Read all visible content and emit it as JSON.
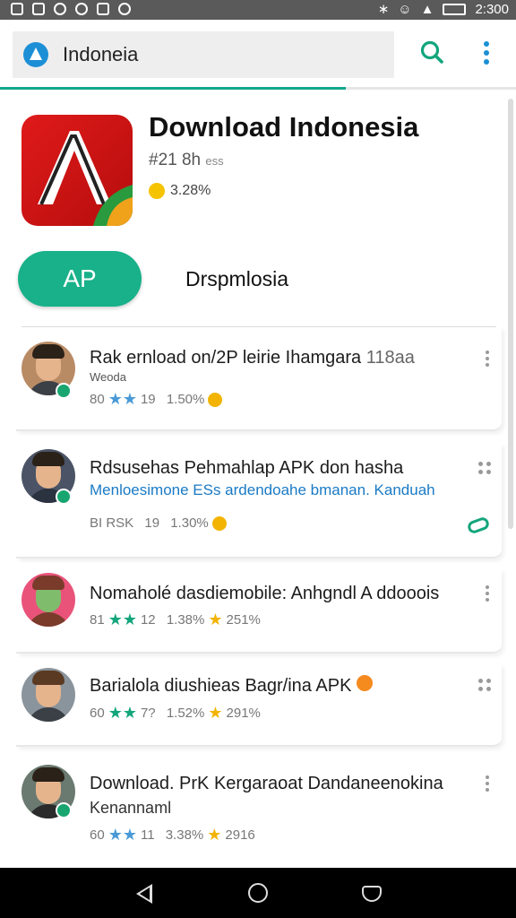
{
  "status_bar": {
    "time": "2:300"
  },
  "search": {
    "query": "Indoneia"
  },
  "load_progress": 0.67,
  "app": {
    "title": "Download Indonesia",
    "rank": "#21 8h",
    "rank_suffix": "ess",
    "rating": "3.28%",
    "install_label": "AP",
    "developer": "Drspmlosia"
  },
  "list": [
    {
      "title": "Rak ernload on/2P leirie Ihamgara",
      "title_suffix": "118aa",
      "subtitle": "Weoda",
      "meta_prefix": "80",
      "meta_count": "19",
      "meta_percent": "1.50%",
      "meta_extra": ""
    },
    {
      "title": "Rdsusehas Pehmahlap  APK don hasha",
      "title_suffix": "",
      "subtitle": "Menloesimone ESs ardendoahe bmanan. Kanduah",
      "meta_prefix": "BI RSK",
      "meta_count": "19",
      "meta_percent": "1.30%",
      "meta_extra": ""
    },
    {
      "title": "Nomaholé dasdiemobile: Anhgndl A ddooois",
      "title_suffix": "",
      "subtitle": "",
      "meta_prefix": "81",
      "meta_count": "12",
      "meta_percent": "1.38%",
      "meta_extra": "251%"
    },
    {
      "title": "Barialola diushieas Bagr/ina APK",
      "title_suffix": "",
      "subtitle": "",
      "meta_prefix": "60",
      "meta_count": "7?",
      "meta_percent": "1.52%",
      "meta_extra": "291%"
    },
    {
      "title": "Download. PrK Kergaraoat Dandaneenokina",
      "title_suffix": "",
      "subtitle": "Kenannaml",
      "meta_prefix": "60",
      "meta_count": "11",
      "meta_percent": "3.38%",
      "meta_extra": "2916"
    }
  ],
  "colors": {
    "accent": "#18b189",
    "link": "#1a7ac5",
    "icon_red": "#e01a1a"
  }
}
